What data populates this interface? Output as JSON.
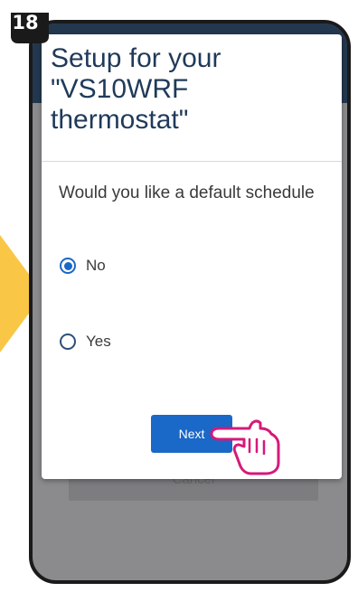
{
  "step_badge": "18",
  "modal": {
    "title": "Setup for your \"VS10WRF thermostat\"",
    "question": "Would you like a default schedule",
    "options": [
      {
        "label": "No",
        "selected": true
      },
      {
        "label": "Yes",
        "selected": false
      }
    ],
    "next_label": "Next"
  },
  "background": {
    "cancel_label": "Cancel"
  },
  "colors": {
    "accent": "#1a68c7",
    "title": "#1f3a5a",
    "header": "#23384f",
    "arrow": "#f9c646",
    "badge": "#1a1a1a",
    "hand_outline": "#d6197a"
  },
  "icons": {
    "pointer": "pointing-hand-icon",
    "arrow": "arrow-right-icon"
  }
}
